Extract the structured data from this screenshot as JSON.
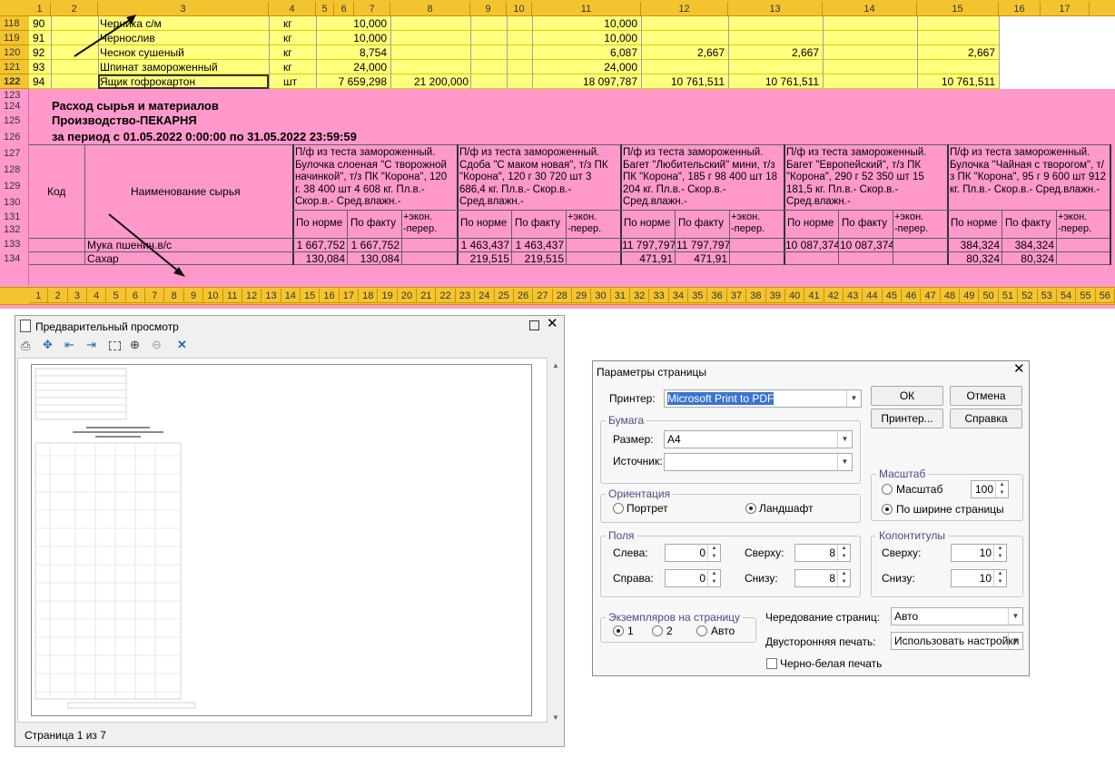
{
  "sheet": {
    "col_headers": [
      "1",
      "2",
      "3",
      "4",
      "5",
      "6",
      "7",
      "8",
      "9",
      "10",
      "11",
      "12",
      "13",
      "14",
      "15",
      "16",
      "17"
    ],
    "top_rows": [
      {
        "rn": "118",
        "n": "90",
        "name": "Черника с/м",
        "unit": "кг",
        "c7": "10,000",
        "c8": "",
        "c11": "10,000",
        "c12": "",
        "c13": "",
        "c15": ""
      },
      {
        "rn": "119",
        "n": "91",
        "name": "Чернослив",
        "unit": "кг",
        "c7": "10,000",
        "c8": "",
        "c11": "10,000",
        "c12": "",
        "c13": "",
        "c15": ""
      },
      {
        "rn": "120",
        "n": "92",
        "name": "Чеснок сушеный",
        "unit": "кг",
        "c7": "8,754",
        "c8": "",
        "c11": "6,087",
        "c12": "2,667",
        "c13": "2,667",
        "c15": "2,667"
      },
      {
        "rn": "121",
        "n": "93",
        "name": "Шпинат замороженный",
        "unit": "кг",
        "c7": "24,000",
        "c8": "",
        "c11": "24,000",
        "c12": "",
        "c13": "",
        "c15": ""
      },
      {
        "rn": "122",
        "n": "94",
        "name": "Ящик гофрокартон",
        "unit": "шт",
        "c7": "7 659,298",
        "c8": "21 200,000",
        "c11": "18 097,787",
        "c12": "10 761,511",
        "c13": "10 761,511",
        "c15": "10 761,511"
      }
    ],
    "pink_row_numbers": [
      "123",
      "124",
      "125",
      "126",
      "127",
      "128",
      "129",
      "130",
      "131",
      "132",
      "133",
      "134"
    ],
    "report_title": "Расход сырья и материалов",
    "report_subtitle": "Производство-ПЕКАРНЯ",
    "report_period": "за период с 01.05.2022 0:00:00 по 31.05.2022 23:59:59",
    "col_code": "Код",
    "col_name": "Наименование сырья",
    "products": [
      "П/ф из теста замороженный. Булочка слоеная \"С творожной начинкой\", т/з ПК \"Корона\", 120 г. 38 400 шт 4 608 кг. Пл.в.- Скор.в.- Сред.влажн.-",
      "П/ф из теста замороженный. Сдоба \"С маком новая\", т/з ПК \"Корона\", 120 г 30 720 шт 3 686,4 кг. Пл.в.- Скор.в.- Сред.влажн.-",
      "П/ф из теста замороженный. Багет \"Любительский\" мини, т/з ПК \"Корона\", 185 г 98 400 шт 18 204 кг. Пл.в.- Скор.в.- Сред.влажн.-",
      "П/ф из теста замороженный. Багет \"Европейский\", т/з ПК \"Корона\", 290 г 52 350 шт 15 181,5 кг. Пл.в.- Скор.в.- Сред.влажн.-",
      "П/ф из теста замороженный. Булочка \"Чайная с творогом\", т/з ПК \"Корона\", 95 г 9 600 шт 912 кг. Пл.в.- Скор.в.- Сред.влажн.-"
    ],
    "sub_norm": "По норме",
    "sub_fact": "По факту",
    "sub_econ": "+экон. -перер.",
    "materials": [
      {
        "name": "Мука пшенич.в/с",
        "vals": [
          [
            "1 667,752",
            "1 667,752"
          ],
          [
            "1 463,437",
            "1 463,437"
          ],
          [
            "11 797,797",
            "11 797,797"
          ],
          [
            "10 087,374",
            "10 087,374"
          ],
          [
            "384,324",
            "384,324"
          ]
        ]
      },
      {
        "name": "Сахар",
        "vals": [
          [
            "130,084",
            "130,084"
          ],
          [
            "219,515",
            "219,515"
          ],
          [
            "471,91",
            "471,91"
          ],
          [
            "",
            ""
          ],
          [
            "80,324",
            "80,324"
          ]
        ]
      }
    ],
    "bottom_headers": [
      "1",
      "2",
      "3",
      "4",
      "5",
      "6",
      "7",
      "8",
      "9",
      "10",
      "11",
      "12",
      "13",
      "14",
      "15",
      "16",
      "17",
      "18",
      "19",
      "20",
      "21",
      "22",
      "23",
      "24",
      "25",
      "26",
      "27",
      "28",
      "29",
      "30",
      "31",
      "32",
      "33",
      "34",
      "35",
      "36",
      "37",
      "38",
      "39",
      "40",
      "41",
      "42",
      "43",
      "44",
      "45",
      "46",
      "47",
      "48",
      "49",
      "50",
      "51",
      "52",
      "53",
      "54",
      "55",
      "56"
    ]
  },
  "preview": {
    "title": "Предварительный просмотр",
    "status": "Страница 1 из 7",
    "toolbar_icons": [
      "print-icon",
      "move-icon",
      "page-prev-icon",
      "page-next-icon",
      "page-view-icon",
      "zoom-in-icon",
      "zoom-out-icon",
      "close-x-icon"
    ]
  },
  "dialog": {
    "title": "Параметры страницы",
    "printer_label": "Принтер:",
    "printer_value": "Microsoft Print to PDF",
    "ok": "ОК",
    "cancel": "Отмена",
    "printer_btn": "Принтер...",
    "help": "Справка",
    "paper_group": "Бумага",
    "size_label": "Размер:",
    "size_value": "А4",
    "source_label": "Источник:",
    "source_value": "",
    "scale_group": "Масштаб",
    "scale_radio": "Масштаб",
    "scale_value": "100",
    "fit_width": "По ширине страницы",
    "orient_group": "Ориентация",
    "portrait": "Портрет",
    "landscape": "Ландшафт",
    "margins_group": "Поля",
    "left_label": "Слева:",
    "left_value": "0",
    "right_label": "Справа:",
    "right_value": "0",
    "top_label": "Сверху:",
    "top_value": "8",
    "bottom_label": "Снизу:",
    "bottom_value": "8",
    "hf_group": "Колонтитулы",
    "hf_top_label": "Сверху:",
    "hf_top_value": "10",
    "hf_bottom_label": "Снизу:",
    "hf_bottom_value": "10",
    "copies_group": "Экземпляров на страницу",
    "copies_1": "1",
    "copies_2": "2",
    "copies_auto": "Авто",
    "alternate_label": "Чередование страниц:",
    "alternate_value": "Авто",
    "duplex_label": "Двусторонняя печать:",
    "duplex_value": "Использовать настройки",
    "bw_label": "Черно-белая печать"
  }
}
